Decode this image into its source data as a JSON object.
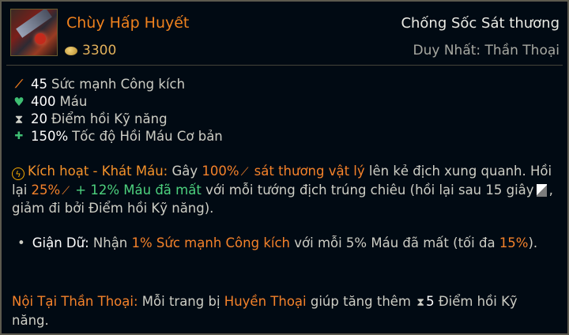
{
  "item": {
    "name": "Chùy Hấp Huyết",
    "gold": "3300",
    "type": "Chống Sốc Sát thương",
    "rarity": "Duy Nhất: Thần Thoại",
    "icon": "goredrinker-item-icon"
  },
  "stats": [
    {
      "icon": "attack-damage-icon",
      "value": "45",
      "label": "Sức mạnh Công kích"
    },
    {
      "icon": "health-icon",
      "value": "400",
      "label": "Máu"
    },
    {
      "icon": "ability-haste-icon",
      "value": "20",
      "label": "Điểm hồi Kỹ năng"
    },
    {
      "icon": "health-regen-icon",
      "value": "150%",
      "label": "Tốc độ Hồi Máu Cơ bản"
    }
  ],
  "active": {
    "name": "Kích hoạt - Khát Máu:",
    "text1": "Gây",
    "dmg_pct": "100%",
    "dmg_type": "sát thương vật lý",
    "text2": "lên kẻ địch xung quanh. Hồi lại",
    "heal_pct": "25%",
    "heal_plus": "+ 12% Máu đã mất",
    "text3": "với mỗi tướng địch trúng chiêu (hồi lại sau 15 giây",
    "text4": ", giảm đi bởi Điểm hồi Kỹ năng)."
  },
  "passive": {
    "bullet": "•",
    "name": "Giận Dữ:",
    "text1": "Nhận",
    "ad_gain": "1% Sức mạnh Công kích",
    "text2": "với mỗi 5% Máu đã mất (tối đa",
    "max": "15%",
    "text3": ")."
  },
  "mythic": {
    "name": "Nội Tại Thần Thoại:",
    "text1": "Mỗi trang bị",
    "legendary": "Huyền Thoại",
    "text2": "giúp tăng thêm",
    "haste": "5",
    "text3": "Điểm hồi Kỹ năng."
  },
  "colors": {
    "item_name": "#f0821e",
    "gold": "#e2b15b",
    "physical": "#f5822a",
    "heal": "#4dd17e",
    "border": "#5c5a4e"
  }
}
